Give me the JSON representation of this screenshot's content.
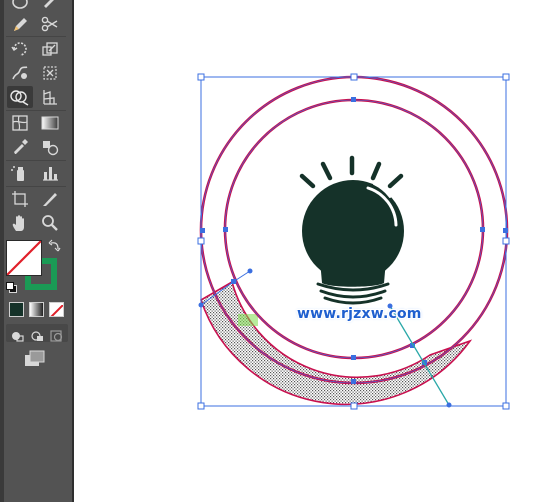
{
  "toolbar": {
    "tools": [
      {
        "name": "ellipse-tool-icon"
      },
      {
        "name": "blob-brush-tool-icon"
      },
      {
        "name": "pencil-tool-icon"
      },
      {
        "name": "scissors-tool-icon"
      },
      {
        "name": "rotate-tool-icon"
      },
      {
        "name": "scale-tool-icon"
      },
      {
        "name": "warp-tool-icon"
      },
      {
        "name": "free-transform-tool-icon"
      },
      {
        "name": "shape-builder-tool-icon"
      },
      {
        "name": "perspective-grid-tool-icon"
      },
      {
        "name": "mesh-tool-icon"
      },
      {
        "name": "gradient-tool-icon"
      },
      {
        "name": "eyedropper-tool-icon"
      },
      {
        "name": "blend-tool-icon"
      },
      {
        "name": "symbol-sprayer-tool-icon"
      },
      {
        "name": "column-graph-tool-icon"
      },
      {
        "name": "artboard-tool-icon"
      },
      {
        "name": "slice-tool-icon"
      },
      {
        "name": "hand-tool-icon"
      },
      {
        "name": "zoom-tool-icon"
      }
    ],
    "fill_color": "#ffffff",
    "stroke_color": "#1a9a55"
  },
  "artwork": {
    "outer_stroke_color": "#c8104f",
    "bulb_color": "#153229",
    "selection_color": "#3b6fe0",
    "watermark": "www.rjzxw.com"
  }
}
